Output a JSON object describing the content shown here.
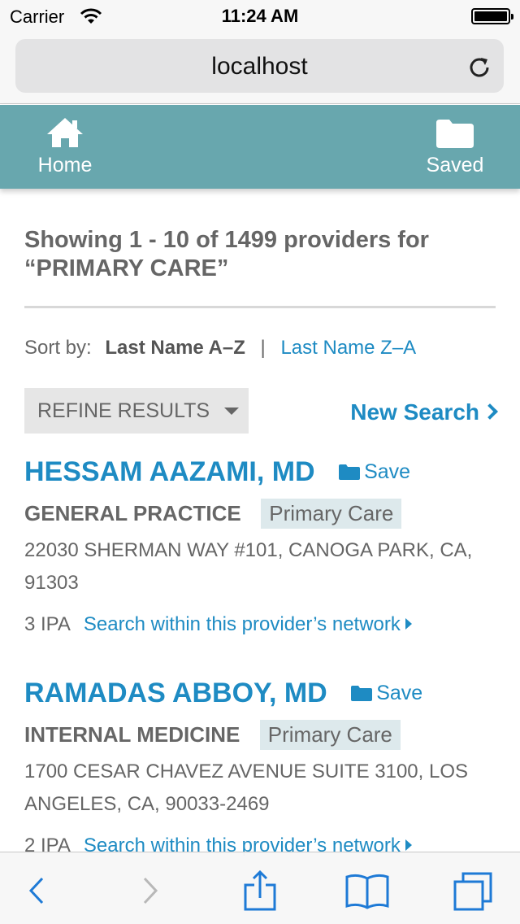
{
  "status_bar": {
    "carrier": "Carrier",
    "time": "11:24 AM"
  },
  "browser": {
    "url": "localhost"
  },
  "header": {
    "home_label": "Home",
    "saved_label": "Saved"
  },
  "results": {
    "heading": "Showing 1 - 10 of 1499 providers for “PRIMARY CARE”",
    "sort_label": "Sort by:",
    "sort_active": "Last Name A–Z",
    "sort_separator": "|",
    "sort_other": "Last Name Z–A",
    "refine_label": "REFINE RESULTS",
    "new_search_label": "New Search"
  },
  "providers": [
    {
      "name": "HESSAM AAZAMI, MD",
      "save_label": "Save",
      "specialty": "GENERAL PRACTICE",
      "tag": "Primary Care",
      "address": "22030 SHERMAN WAY #101, CANOGA PARK, CA, 91303",
      "ipa": "3 IPA",
      "network_link": "Search within this provider’s network"
    },
    {
      "name": "RAMADAS ABBOY, MD",
      "save_label": "Save",
      "specialty": "INTERNAL MEDICINE",
      "tag": "Primary Care",
      "address": "1700 CESAR CHAVEZ AVENUE SUITE 3100, LOS ANGELES, CA, 90033-2469",
      "ipa": "2 IPA",
      "network_link": "Search within this provider’s network"
    }
  ],
  "toolbar": {
    "icons": [
      "back-icon",
      "forward-icon",
      "share-icon",
      "bookmarks-icon",
      "tabs-icon"
    ]
  },
  "colors": {
    "header_bg": "#68a7ae",
    "link": "#1e8bc3",
    "tag_bg": "#dde9ec"
  }
}
